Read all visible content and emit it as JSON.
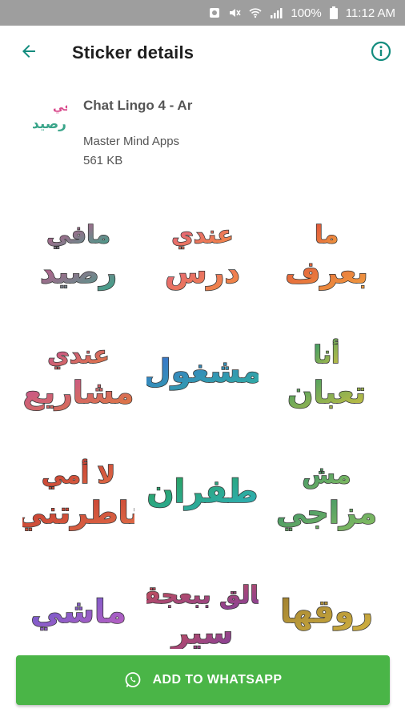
{
  "status_bar": {
    "battery": "100%",
    "time": "11:12 AM"
  },
  "app_bar": {
    "title": "Sticker details"
  },
  "pack": {
    "name": "Chat Lingo 4 - Ar",
    "publisher": "Master Mind Apps",
    "size": "561 KB"
  },
  "stickers": [
    {
      "text": "مافي رصيد",
      "colors": [
        "#d94a8c",
        "#3aa58a"
      ]
    },
    {
      "text": "عندي درس",
      "colors": [
        "#e05a8a",
        "#f28b3c"
      ]
    },
    {
      "text": "ما بعرف",
      "colors": [
        "#e0503a",
        "#f0a040"
      ]
    },
    {
      "text": "عندي مشاريع",
      "colors": [
        "#c24ea0",
        "#e07a3a"
      ]
    },
    {
      "text": "مشغول",
      "colors": [
        "#3a6fd0",
        "#2fb0a0"
      ]
    },
    {
      "text": "أنا تعبان",
      "colors": [
        "#2e9a6a",
        "#d0c040"
      ]
    },
    {
      "text": "لا أمي ناطرتني",
      "colors": [
        "#c0302a",
        "#e0704a"
      ]
    },
    {
      "text": "طفران",
      "colors": [
        "#28a050",
        "#30b0c0"
      ]
    },
    {
      "text": "مش مزاجي",
      "colors": [
        "#2f8a6a",
        "#8ac060"
      ]
    },
    {
      "text": "ماشي",
      "colors": [
        "#5a5ad0",
        "#c060c0"
      ]
    },
    {
      "text": "عالق ببعجقة سير",
      "colors": [
        "#d0504a",
        "#8040a0"
      ]
    },
    {
      "text": "روقها",
      "colors": [
        "#a08030",
        "#d0b040"
      ]
    }
  ],
  "add_button": {
    "label": "ADD TO WHATSAPP"
  },
  "colors": {
    "accent": "#128c7e",
    "button": "#4ab547",
    "status_bar": "#9e9e9e"
  }
}
